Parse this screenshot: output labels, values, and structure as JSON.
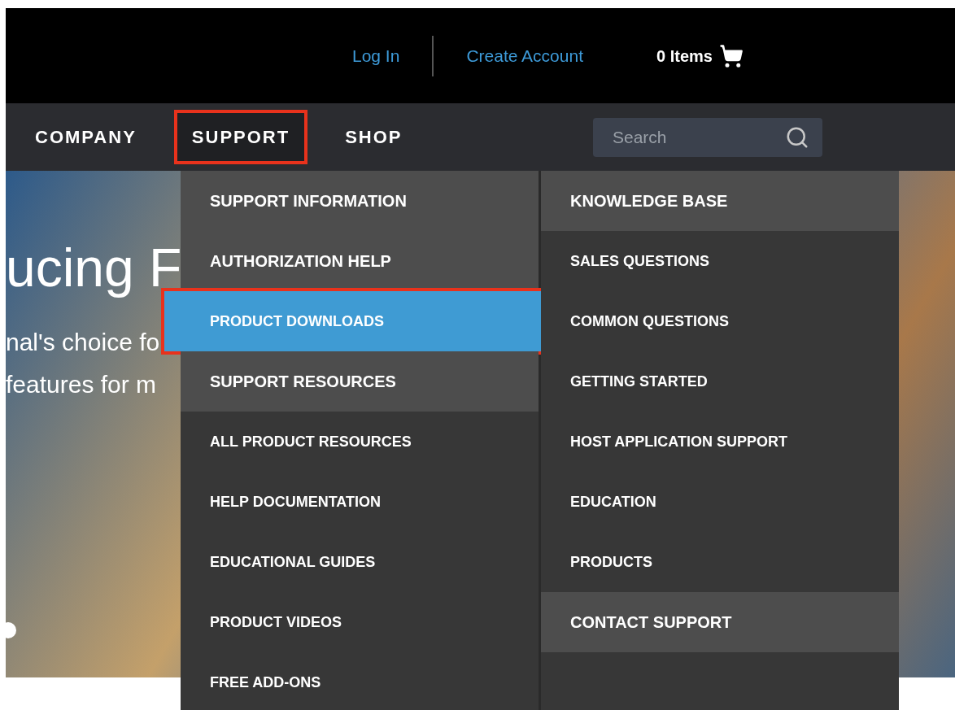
{
  "top_bar": {
    "links": [
      {
        "label": "Log In"
      },
      {
        "label": "Create Account"
      }
    ],
    "cart": {
      "label": "0 Items"
    }
  },
  "nav": {
    "items": [
      {
        "label": "COMPANY",
        "selected": false,
        "annotated": false
      },
      {
        "label": "SUPPORT",
        "selected": true,
        "annotated": true
      },
      {
        "label": "SHOP",
        "selected": false,
        "annotated": false
      }
    ],
    "search": {
      "placeholder": "Search"
    }
  },
  "hero": {
    "headline": "ucing F",
    "lines": [
      "nal's choice fo",
      "features for m"
    ]
  },
  "dropdown": {
    "columns": [
      {
        "items": [
          {
            "kind": "heading",
            "label": "SUPPORT INFORMATION",
            "selected": false,
            "annotated": false
          },
          {
            "kind": "heading",
            "label": "AUTHORIZATION HELP",
            "selected": false,
            "annotated": false
          },
          {
            "kind": "link",
            "label": "PRODUCT DOWNLOADS",
            "selected": true,
            "annotated": true
          },
          {
            "kind": "heading",
            "label": "SUPPORT RESOURCES",
            "selected": false,
            "annotated": false
          },
          {
            "kind": "link",
            "label": "ALL PRODUCT RESOURCES",
            "selected": false,
            "annotated": false
          },
          {
            "kind": "link",
            "label": "HELP DOCUMENTATION",
            "selected": false,
            "annotated": false
          },
          {
            "kind": "link",
            "label": "EDUCATIONAL GUIDES",
            "selected": false,
            "annotated": false
          },
          {
            "kind": "link",
            "label": "PRODUCT VIDEOS",
            "selected": false,
            "annotated": false
          },
          {
            "kind": "link",
            "label": "FREE ADD-ONS",
            "selected": false,
            "annotated": false
          }
        ]
      },
      {
        "items": [
          {
            "kind": "heading",
            "label": "KNOWLEDGE BASE",
            "selected": false,
            "annotated": false
          },
          {
            "kind": "link",
            "label": "SALES QUESTIONS",
            "selected": false,
            "annotated": false
          },
          {
            "kind": "link",
            "label": "COMMON QUESTIONS",
            "selected": false,
            "annotated": false
          },
          {
            "kind": "link",
            "label": "GETTING STARTED",
            "selected": false,
            "annotated": false
          },
          {
            "kind": "link",
            "label": "HOST APPLICATION SUPPORT",
            "selected": false,
            "annotated": false
          },
          {
            "kind": "link",
            "label": "EDUCATION",
            "selected": false,
            "annotated": false
          },
          {
            "kind": "link",
            "label": "PRODUCTS",
            "selected": false,
            "annotated": false
          },
          {
            "kind": "heading",
            "label": "CONTACT SUPPORT",
            "selected": false,
            "annotated": false
          }
        ]
      }
    ]
  }
}
